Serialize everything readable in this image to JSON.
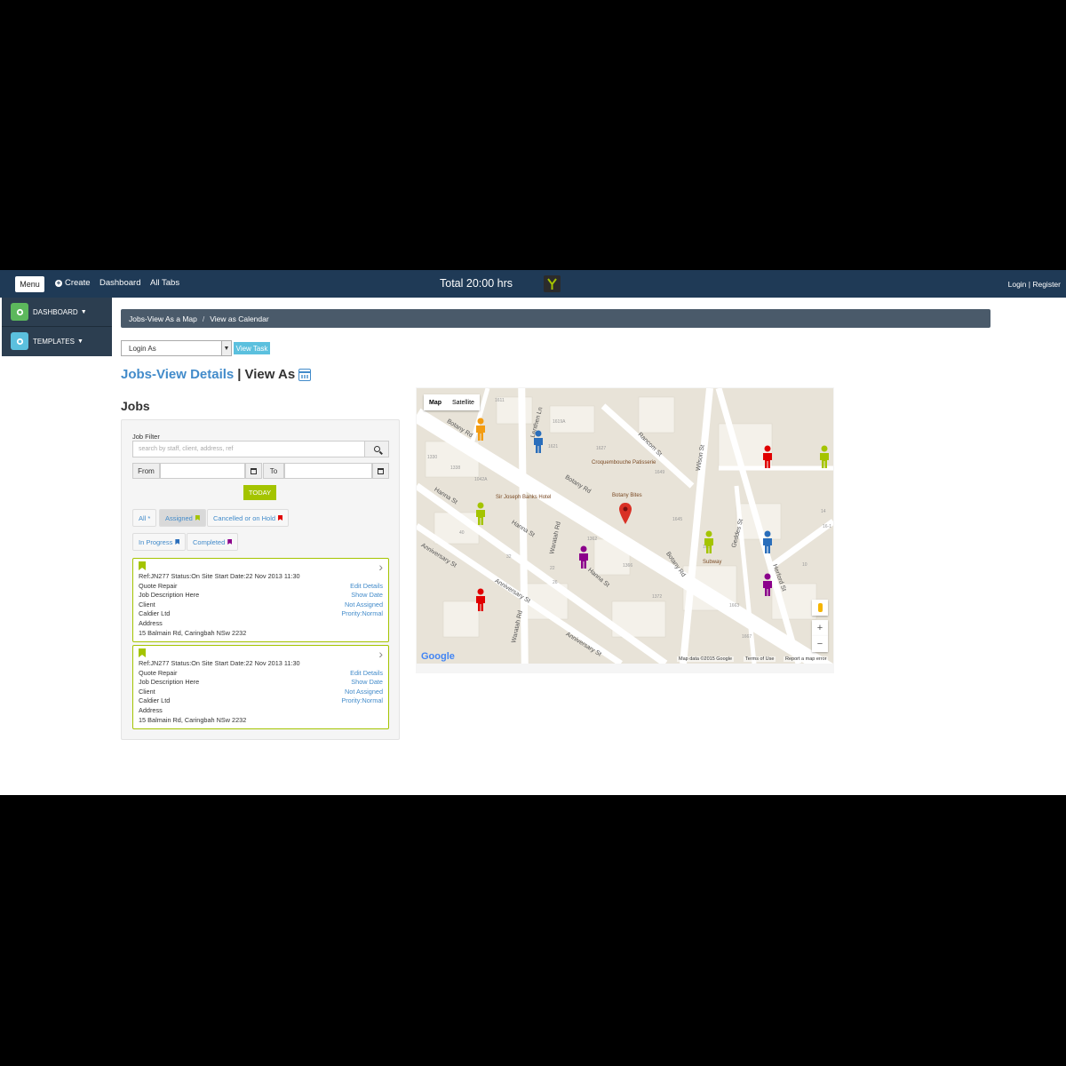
{
  "topnav": {
    "menu_label": "Menu",
    "create_label": "Create",
    "dashboard_label": "Dashboard",
    "alltabs_label": "All Tabs",
    "total_label": "Total 20:00 hrs",
    "login_label": "Login | Register"
  },
  "sidebar": {
    "items": [
      {
        "label": "DASHBOARD",
        "color": "#5cb85c"
      },
      {
        "label": "TEMPLATES",
        "color": "#5bc0de"
      }
    ]
  },
  "breadcrumb": {
    "items": [
      "Jobs-View As a Map",
      "View as Calendar"
    ],
    "separator": "/"
  },
  "login_select": {
    "value": "Login As"
  },
  "view_task_label": "View Task",
  "page_title": {
    "link": "Jobs-View Details",
    "separator": "|",
    "rest": "View As"
  },
  "jobs_heading": "Jobs",
  "filter": {
    "label": "Job Filter",
    "search_placeholder": "search by staff, client, address, ref",
    "from_label": "From",
    "to_label": "To",
    "today_label": "TODAY",
    "pills": [
      {
        "label": "All *",
        "active": false,
        "flag": ""
      },
      {
        "label": "Assigned",
        "active": true,
        "flag": "#a4c400"
      },
      {
        "label": "Cancelled or on Hold",
        "active": false,
        "flag": "#e00000"
      },
      {
        "label": "In Progress",
        "active": false,
        "flag": "#2a6ebb"
      },
      {
        "label": "Completed",
        "active": false,
        "flag": "#8b008b"
      }
    ]
  },
  "jobs": [
    {
      "ref_line": "Ref:JN277 Status:On Site Start Date:22 Nov 2013 11:30",
      "title": "Quote Repair",
      "description": "Job Description Here",
      "client_label": "Client",
      "client": "Caldier Ltd",
      "address_label": "Address",
      "address": "15 Balmain Rd, Caringbah NSw 2232",
      "edit": "Edit Details",
      "show_date": "Show Date",
      "assignment": "Not Assigned",
      "priority": "Prority:Normal"
    },
    {
      "ref_line": "Ref:JN277 Status:On Site Start Date:22 Nov 2013 11:30",
      "title": "Quote Repair",
      "description": "Job Description Here",
      "client_label": "Client",
      "client": "Caldier Ltd",
      "address_label": "Address",
      "address": "15 Balmain Rd, Caringbah NSw 2232",
      "edit": "Edit Details",
      "show_date": "Show Date",
      "assignment": "Not Assigned",
      "priority": "Prority:Normal"
    }
  ],
  "map": {
    "type_map": "Map",
    "type_satellite": "Satellite",
    "zoom_in": "+",
    "zoom_out": "−",
    "logo": "Google",
    "attribution": "Map data ©2015 Google",
    "terms": "Terms of Use",
    "report": "Report a map error",
    "streets": [
      "Botany Rd",
      "Botany Rd",
      "Botany Rd",
      "Lenthen Ln",
      "Rancom St",
      "Wilson St",
      "Hanna St",
      "Hanna St",
      "Hanna St",
      "Waratah Rd",
      "Waratah Rd",
      "Anniversary St",
      "Anniversary St",
      "Anniversary St",
      "Geddes St",
      "Herford St"
    ],
    "pois": [
      "Croquembouche Patisserie",
      "Sir Joseph Banks Hotel",
      "Botany Bites",
      "Subway"
    ],
    "numbers": [
      "1611",
      "1619A",
      "1627",
      "1621",
      "1649",
      "1645",
      "1330",
      "1338",
      "1042A",
      "1362",
      "1366",
      "1372",
      "1657",
      "1663",
      "1667",
      "14",
      "16-1",
      "22",
      "26",
      "40",
      "32",
      "10"
    ],
    "staff_colors": [
      "#f39c12",
      "#2a6ebb",
      "#e00000",
      "#a4c400",
      "#a4c400",
      "#a4c400",
      "#8b008b",
      "#2a6ebb",
      "#8b008b",
      "#e00000"
    ]
  }
}
